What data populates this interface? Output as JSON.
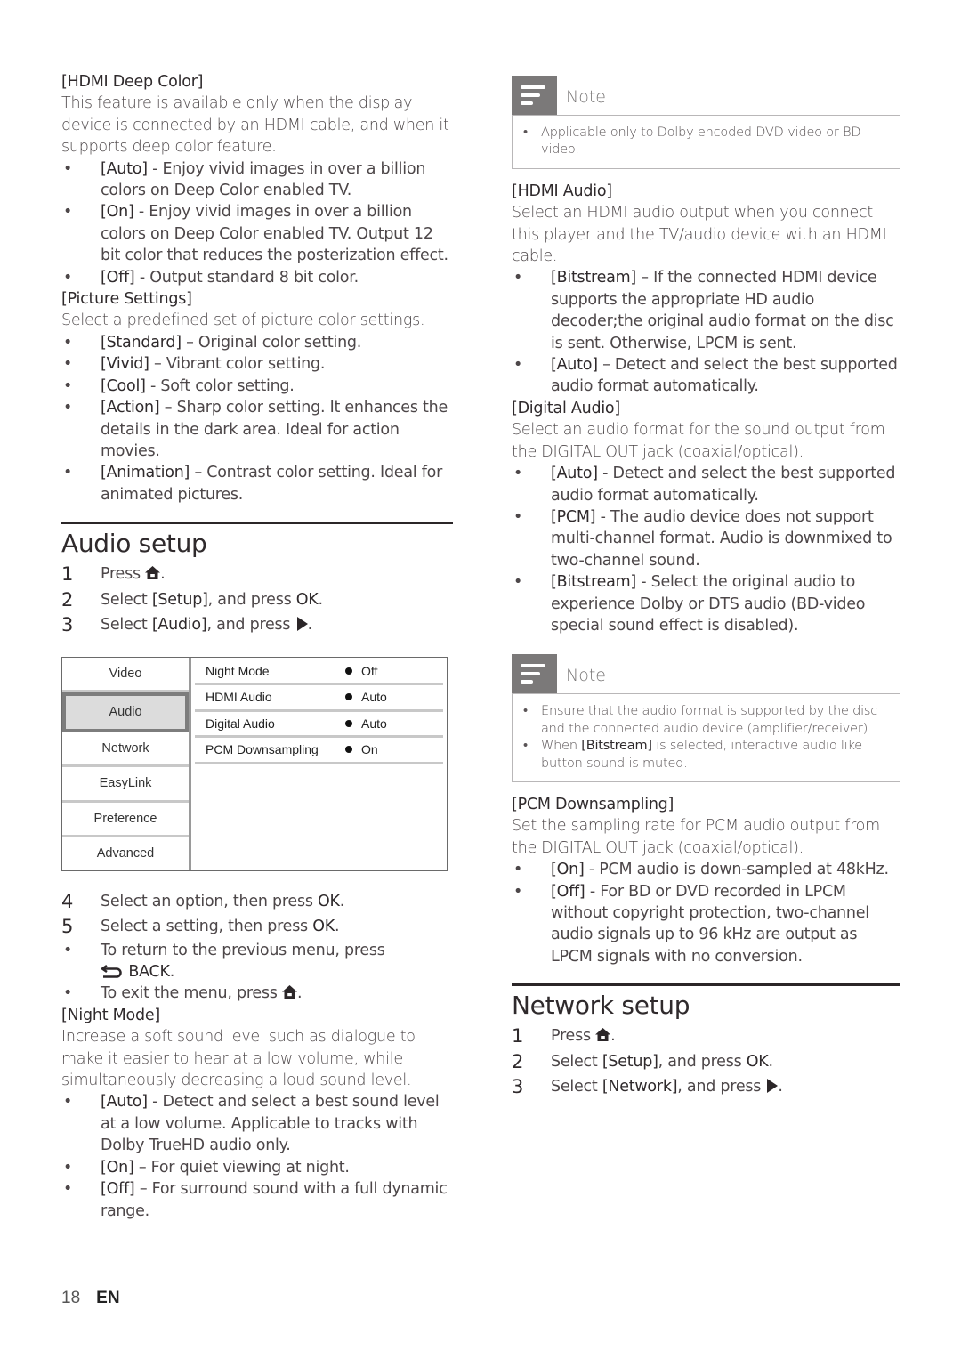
{
  "left": {
    "hdmi_deep_color": {
      "title": "[HDMI Deep Color]",
      "desc": "This feature is available only when the display device is connected by an HDMI cable, and when it supports deep color feature.",
      "options": [
        {
          "key": "[Auto]",
          "text": " - Enjoy vivid images in over a billion colors on Deep Color enabled TV."
        },
        {
          "key": "[On]",
          "text": " - Enjoy vivid images in over a billion colors on Deep Color enabled TV. Output 12 bit color that reduces the posterization effect."
        },
        {
          "key": "[Off]",
          "text": " - Output standard 8 bit color."
        }
      ]
    },
    "picture_settings": {
      "title": "[Picture Settings]",
      "desc": "Select a predefined set of picture color settings.",
      "options": [
        {
          "key": "[Standard]",
          "text": " – Original color setting."
        },
        {
          "key": "[Vivid]",
          "text": " – Vibrant color setting."
        },
        {
          "key": "[Cool]",
          "text": " - Soft color setting."
        },
        {
          "key": "[Action]",
          "text": " – Sharp color setting. It enhances the details in the dark area. Ideal for action movies."
        },
        {
          "key": "[Animation]",
          "text": " – Contrast color setting. Ideal for animated pictures."
        }
      ]
    },
    "audio_setup": {
      "title": "Audio setup",
      "steps": [
        {
          "num": "1",
          "pre": "Press ",
          "icon": "home-icon",
          "post": "."
        },
        {
          "num": "2",
          "pre": "Select ",
          "key": "[Setup]",
          "mid": ", and press ",
          "key2": "OK",
          "post": "."
        },
        {
          "num": "3",
          "pre": "Select ",
          "key": "[Audio]",
          "mid": ", and press ",
          "icon": "play-icon",
          "post": "."
        }
      ],
      "menu": {
        "tabs": [
          "Video",
          "Audio",
          "Network",
          "EasyLink",
          "Preference",
          "Advanced"
        ],
        "active_tab": "Audio",
        "rows": [
          {
            "label": "Night Mode",
            "value": "Off"
          },
          {
            "label": "HDMI Audio",
            "value": "Auto"
          },
          {
            "label": "Digital Audio",
            "value": "Auto"
          },
          {
            "label": "PCM Downsampling",
            "value": "On"
          }
        ]
      },
      "steps2": [
        {
          "num": "4",
          "pre": "Select an option, then press ",
          "key2": "OK",
          "post": "."
        },
        {
          "num": "5",
          "pre": "Select a setting, then press ",
          "key2": "OK",
          "post": "."
        }
      ],
      "sub_bullets": [
        {
          "pre": "To return to the previous menu, press",
          "icon": "back-icon",
          "key": "BACK",
          "post": "."
        },
        {
          "pre": "To exit the menu, press",
          "icon": "home-icon",
          "post": "."
        }
      ]
    },
    "night_mode": {
      "title": "[Night Mode]",
      "desc": "Increase a soft sound level such as dialogue to make it easier to hear at a low volume, while simultaneously decreasing a loud sound level.",
      "options": [
        {
          "key": "[Auto]",
          "text": " - Detect and select a best sound level at a low volume. Applicable to tracks with Dolby TrueHD audio only."
        },
        {
          "key": "[On]",
          "text": " – For quiet viewing at night."
        },
        {
          "key": "[Off]",
          "text": " – For surround sound with a full dynamic range."
        }
      ]
    }
  },
  "right": {
    "note1": {
      "title": "Note",
      "items": [
        {
          "pre": "Applicable only to Dolby encoded DVD-video or BD-video."
        }
      ]
    },
    "hdmi_audio": {
      "title": "[HDMI Audio]",
      "desc": "Select an HDMI audio output when you connect this player and the TV/audio device with an HDMI cable.",
      "options": [
        {
          "key": "[Bitstream]",
          "text": " – If the connected HDMI device supports the appropriate HD audio decoder;the original audio format on the disc is sent. Otherwise, LPCM is sent."
        },
        {
          "key": "[Auto]",
          "text": " – Detect and select the best supported audio format automatically."
        }
      ]
    },
    "digital_audio": {
      "title": "[Digital Audio]",
      "desc": "Select an audio format for the sound output from the DIGITAL OUT jack (coaxial/optical).",
      "options": [
        {
          "key": "[Auto]",
          "text": " - Detect and select the best supported audio format automatically."
        },
        {
          "key": "[PCM]",
          "text": " - The audio device does not support multi-channel format. Audio is downmixed to two-channel sound."
        },
        {
          "key": "[Bitstream]",
          "text": " - Select the original audio to experience Dolby or DTS audio (BD-video special sound effect is disabled)."
        }
      ]
    },
    "note2": {
      "title": "Note",
      "items": [
        {
          "pre": "Ensure that the audio format is supported by the disc and the connected audio device (amplifier/receiver)."
        },
        {
          "pre": "When ",
          "key": "[Bitstream]",
          "post": " is selected, interactive audio like button sound is muted."
        }
      ]
    },
    "pcm_downsampling": {
      "title": "[PCM Downsampling]",
      "desc": "Set the sampling rate for PCM audio output from the DIGITAL OUT jack (coaxial/optical).",
      "options": [
        {
          "key": "[On]",
          "text": " - PCM audio is down-sampled at 48kHz."
        },
        {
          "key": "[Off]",
          "text": " - For BD or DVD recorded in LPCM without copyright protection, two-channel audio signals up to 96 kHz are output as LPCM signals with no conversion."
        }
      ]
    },
    "network_setup": {
      "title": "Network setup",
      "steps": [
        {
          "num": "1",
          "pre": "Press ",
          "icon": "home-icon",
          "post": "."
        },
        {
          "num": "2",
          "pre": "Select ",
          "key": "[Setup]",
          "mid": ", and press ",
          "key2": "OK",
          "post": "."
        },
        {
          "num": "3",
          "pre": "Select ",
          "key": "[Network]",
          "mid": ", and press ",
          "icon": "play-icon",
          "post": "."
        }
      ]
    }
  },
  "footer": {
    "page_number": "18",
    "language": "EN"
  }
}
